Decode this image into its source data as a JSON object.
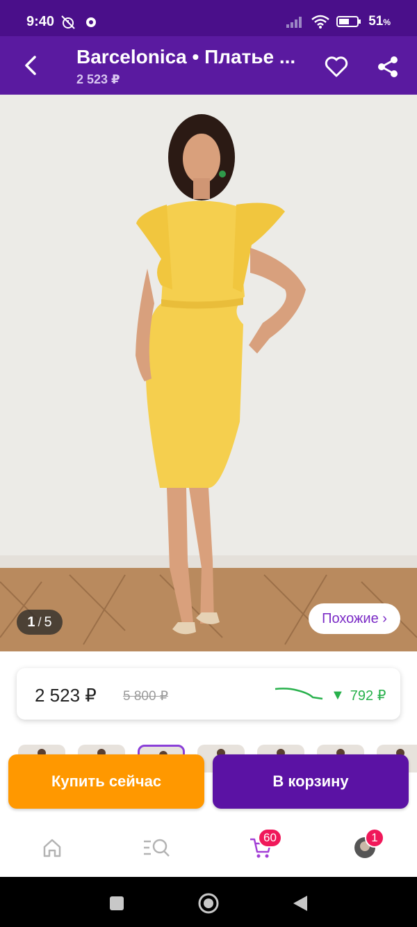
{
  "status_bar": {
    "time": "9:40",
    "battery": "51",
    "battery_unit": "%"
  },
  "header": {
    "title": "Barcelonica • Платье ...",
    "price": "2 523 ₽"
  },
  "gallery": {
    "current_page": "1",
    "separator": "/",
    "total_pages": "5",
    "similar_label": "Похожие ›"
  },
  "price_card": {
    "current_price": "2 523 ₽",
    "old_price": "5 800 ₽",
    "price_drop": "792 ₽",
    "drop_arrow": "▼"
  },
  "actions": {
    "buy_now_label": "Купить сейчас",
    "add_to_cart_label": "В корзину"
  },
  "bottom_nav": {
    "cart_badge": "60",
    "profile_badge": "1"
  },
  "colors": {
    "accent_purple": "#5a1aa0",
    "buy_orange": "#ff9800",
    "cart_purple": "#5b12a4",
    "badge_pink": "#f0185a",
    "price_drop_green": "#28b14c",
    "dress_yellow": "#f5cf4e"
  },
  "icons": [
    "back-arrow-icon",
    "heart-icon",
    "share-icon",
    "home-icon",
    "catalog-search-icon",
    "cart-icon",
    "avatar"
  ]
}
